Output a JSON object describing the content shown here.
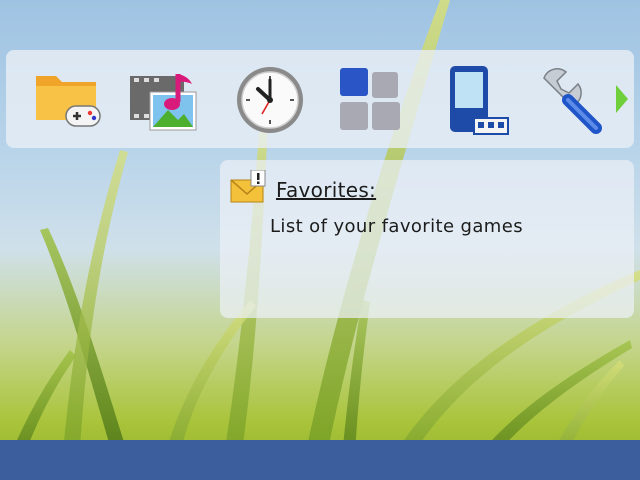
{
  "menu": {
    "items": [
      {
        "name": "games-folder-icon"
      },
      {
        "name": "media-gallery-icon"
      },
      {
        "name": "clock-icon"
      },
      {
        "name": "applications-grid-icon"
      },
      {
        "name": "mobile-device-icon"
      },
      {
        "name": "settings-tools-icon"
      }
    ],
    "scroll_next_icon": "chevron-right-icon"
  },
  "info": {
    "icon": "new-message-icon",
    "title": "Favorites:",
    "description": "List of your favorite games"
  },
  "colors": {
    "bottom_bar": "#3d5e9c",
    "scroll_arrow": "#6fcf3a",
    "title_text": "#1c1c1c"
  }
}
